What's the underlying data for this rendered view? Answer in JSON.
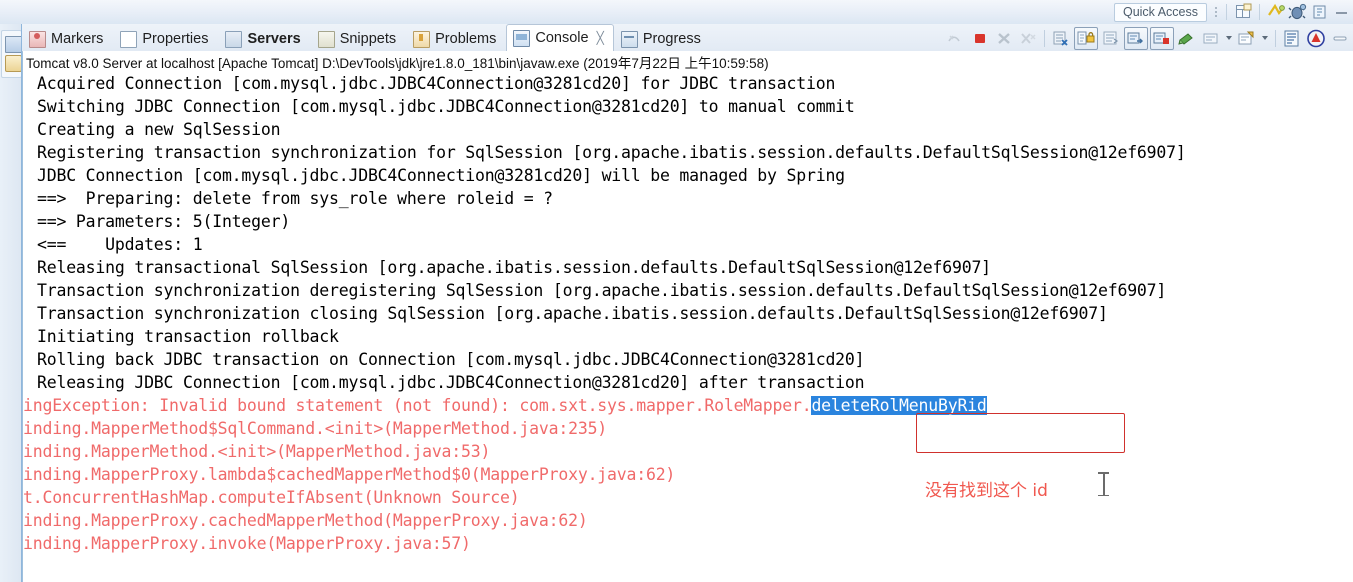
{
  "topbar": {
    "quick_access_label": "Quick Access",
    "icons": [
      "perspective-add-icon",
      "java-ee-perspective-icon",
      "debug-perspective-icon",
      "java-perspective-icon"
    ]
  },
  "tabs": [
    {
      "label": "Markers",
      "icon": "markers-icon",
      "active": false,
      "bold": false,
      "closable": false
    },
    {
      "label": "Properties",
      "icon": "properties-icon",
      "active": false,
      "bold": false,
      "closable": false
    },
    {
      "label": "Servers",
      "icon": "servers-icon",
      "active": false,
      "bold": true,
      "closable": false
    },
    {
      "label": "Snippets",
      "icon": "snippets-icon",
      "active": false,
      "bold": false,
      "closable": false
    },
    {
      "label": "Problems",
      "icon": "problems-icon",
      "active": false,
      "bold": false,
      "closable": false
    },
    {
      "label": "Console",
      "icon": "console-icon",
      "active": true,
      "bold": false,
      "closable": true
    },
    {
      "label": "Progress",
      "icon": "progress-icon",
      "active": false,
      "bold": false,
      "closable": false
    }
  ],
  "tab_close_glyph": "╳",
  "console_toolbar": [
    {
      "name": "terminate-all-icon",
      "enabled": false,
      "framed": false
    },
    {
      "name": "terminate-icon",
      "enabled": true,
      "framed": false
    },
    {
      "name": "remove-launch-icon",
      "enabled": false,
      "framed": false
    },
    {
      "name": "remove-all-launches-icon",
      "enabled": false,
      "framed": false
    },
    {
      "name": "separator",
      "enabled": true,
      "framed": false
    },
    {
      "name": "clear-console-icon",
      "enabled": true,
      "framed": false
    },
    {
      "name": "scroll-lock-icon",
      "enabled": true,
      "framed": true
    },
    {
      "name": "word-wrap-icon",
      "enabled": true,
      "framed": false
    },
    {
      "name": "show-console-on-output-icon",
      "enabled": true,
      "framed": true
    },
    {
      "name": "show-console-on-error-icon",
      "enabled": true,
      "framed": true
    },
    {
      "name": "separator",
      "enabled": true,
      "framed": false
    },
    {
      "name": "pin-console-icon",
      "enabled": true,
      "framed": false
    },
    {
      "name": "display-selected-console-icon",
      "enabled": true,
      "framed": false
    },
    {
      "name": "display-console-dropdown-icon",
      "enabled": true,
      "framed": false
    },
    {
      "name": "open-console-icon",
      "enabled": true,
      "framed": false
    },
    {
      "name": "open-console-dropdown-icon",
      "enabled": true,
      "framed": false
    },
    {
      "name": "separator",
      "enabled": true,
      "framed": false
    },
    {
      "name": "view-menu-icon",
      "enabled": true,
      "framed": false
    },
    {
      "name": "tomcat-icon",
      "enabled": true,
      "framed": false
    },
    {
      "name": "minimize-view-icon",
      "enabled": true,
      "framed": false
    }
  ],
  "left_strip": {
    "icons": [
      "package-explorer-icon",
      "servers-view-icon"
    ]
  },
  "process_line": "Tomcat v8.0 Server at localhost [Apache Tomcat] D:\\DevTools\\jdk\\jre1.8.0_181\\bin\\javaw.exe (2019年7月22日 上午10:59:58)",
  "console": {
    "selection": {
      "text": "deleteRolMenuByRid",
      "bg_color": "#2a84de",
      "fg_color": "#ffffff"
    },
    "error_color": "#f06a6a",
    "lines": [
      {
        "text": "Acquired Connection [com.mysql.jdbc.JDBC4Connection@3281cd20] for JDBC transaction",
        "level": "info"
      },
      {
        "text": "Switching JDBC Connection [com.mysql.jdbc.JDBC4Connection@3281cd20] to manual commit",
        "level": "info"
      },
      {
        "text": "Creating a new SqlSession",
        "level": "info"
      },
      {
        "text": "Registering transaction synchronization for SqlSession [org.apache.ibatis.session.defaults.DefaultSqlSession@12ef6907]",
        "level": "info"
      },
      {
        "text": "JDBC Connection [com.mysql.jdbc.JDBC4Connection@3281cd20] will be managed by Spring",
        "level": "info"
      },
      {
        "text": "==>  Preparing: delete from sys_role where roleid = ?",
        "level": "info"
      },
      {
        "text": "==> Parameters: 5(Integer)",
        "level": "info"
      },
      {
        "text": "<==    Updates: 1",
        "level": "info"
      },
      {
        "text": "Releasing transactional SqlSession [org.apache.ibatis.session.defaults.DefaultSqlSession@12ef6907]",
        "level": "info"
      },
      {
        "text": "Transaction synchronization deregistering SqlSession [org.apache.ibatis.session.defaults.DefaultSqlSession@12ef6907]",
        "level": "info"
      },
      {
        "text": "Transaction synchronization closing SqlSession [org.apache.ibatis.session.defaults.DefaultSqlSession@12ef6907]",
        "level": "info"
      },
      {
        "text": "Initiating transaction rollback",
        "level": "info"
      },
      {
        "text": "Rolling back JDBC transaction on Connection [com.mysql.jdbc.JDBC4Connection@3281cd20]",
        "level": "info"
      },
      {
        "text": "Releasing JDBC Connection [com.mysql.jdbc.JDBC4Connection@3281cd20] after transaction",
        "level": "info"
      },
      {
        "prefix": "ingException: Invalid bound statement (not found): com.sxt.sys.mapper.RoleMapper.",
        "selected": "deleteRolMenuByRid",
        "level": "error"
      },
      {
        "text": "inding.MapperMethod$SqlCommand.<init>(MapperMethod.java:235)",
        "level": "error"
      },
      {
        "text": "inding.MapperMethod.<init>(MapperMethod.java:53)",
        "level": "error"
      },
      {
        "text": "inding.MapperProxy.lambda$cachedMapperMethod$0(MapperProxy.java:62)",
        "level": "error"
      },
      {
        "text": "t.ConcurrentHashMap.computeIfAbsent(Unknown Source)",
        "level": "error"
      },
      {
        "text": "inding.MapperProxy.cachedMapperMethod(MapperProxy.java:62)",
        "level": "error"
      },
      {
        "text": "inding.MapperProxy.invoke(MapperProxy.java:57)",
        "level": "error"
      }
    ]
  },
  "annotation": {
    "note_text": "没有找到这个 id",
    "note_color": "#f0584f",
    "box_color": "#d0312d"
  }
}
